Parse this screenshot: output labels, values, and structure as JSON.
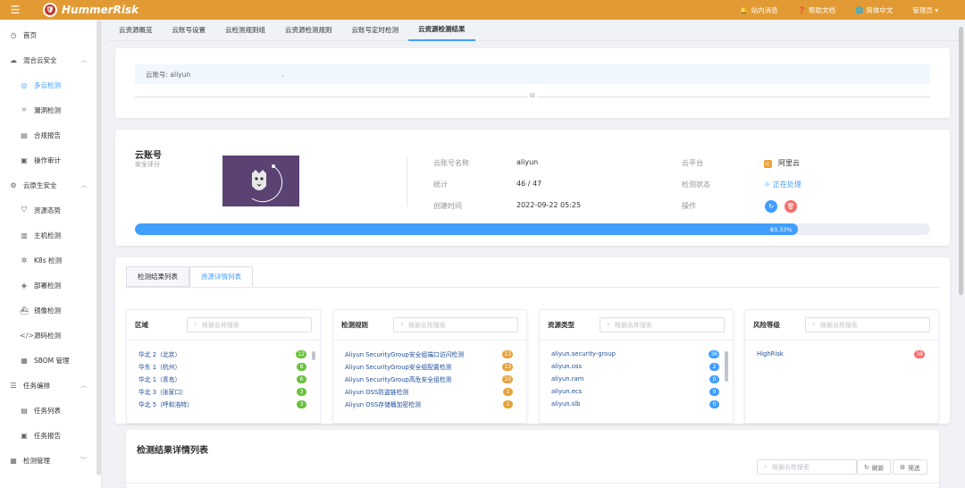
{
  "header": {
    "brand": "HummerRisk",
    "messages": "站内消息",
    "help": "帮助文档",
    "language": "简体中文",
    "user": "管理员"
  },
  "sidebar": {
    "items": [
      {
        "label": "首页",
        "icon": "clock-icon"
      },
      {
        "label": "混合云安全",
        "icon": "cloud-icon"
      },
      {
        "label": "多云检测",
        "icon": "scan-icon"
      },
      {
        "label": "漏洞检测",
        "icon": "bug-icon"
      },
      {
        "label": "合规报告",
        "icon": "report-icon"
      },
      {
        "label": "操作审计",
        "icon": "audit-icon"
      },
      {
        "label": "云原生安全",
        "icon": "gear-icon"
      },
      {
        "label": "资源态势",
        "icon": "shield-icon"
      },
      {
        "label": "主机检测",
        "icon": "server-icon"
      },
      {
        "label": "K8s 检测",
        "icon": "k8s-icon"
      },
      {
        "label": "部署检测",
        "icon": "layers-icon"
      },
      {
        "label": "镜像检测",
        "icon": "image-icon"
      },
      {
        "label": "源码检测",
        "icon": "code-icon"
      },
      {
        "label": "SBOM 管理",
        "icon": "sbom-icon"
      },
      {
        "label": "任务编排",
        "icon": "list-icon"
      },
      {
        "label": "任务列表",
        "icon": "task-icon"
      },
      {
        "label": "任务报告",
        "icon": "doc-icon"
      },
      {
        "label": "检测管理",
        "icon": "grid-icon"
      }
    ]
  },
  "tabs": [
    "云资源概览",
    "云账号设置",
    "云检测规则组",
    "云资源检测规则",
    "云账号定时检测",
    "云资源检测结果"
  ],
  "filter": {
    "account": "云账号: aliyun"
  },
  "account": {
    "title": "云账号",
    "subtitle": "安全评分",
    "name_label": "云账号名称",
    "name_value": "aliyun",
    "stats_label": "统计",
    "stats_value": "46 / 47",
    "created_label": "创建时间",
    "created_value": "2022-09-22 05:25",
    "platform_label": "云平台",
    "platform_value": "阿里云",
    "status_label": "检测状态",
    "status_value": "正在处理",
    "ops_label": "操作",
    "progress": 83.33,
    "progress_text": "83.33%"
  },
  "result_tabs": [
    "检测结果列表",
    "资源详情列表"
  ],
  "panels": [
    {
      "title": "区域",
      "placeholder": "根据名称搜索",
      "rows": [
        {
          "name": "华北 2（北京）",
          "count": "12"
        },
        {
          "name": "华东 1（杭州）",
          "count": "8"
        },
        {
          "name": "华北 1（青岛）",
          "count": "6"
        },
        {
          "name": "华北 3（张家口）",
          "count": "3"
        },
        {
          "name": "华北 5（呼和浩特）",
          "count": "3"
        }
      ]
    },
    {
      "title": "检测规则",
      "placeholder": "根据名称搜索",
      "rows": [
        {
          "name": "Aliyun SecurityGroup安全组端口访问检测",
          "count": "13"
        },
        {
          "name": "Aliyun SecurityGroup安全组配置检测",
          "count": "13"
        },
        {
          "name": "Aliyun SecurityGroup高危安全组检测",
          "count": "10"
        },
        {
          "name": "Aliyun OSS防盗链检测",
          "count": "1"
        },
        {
          "name": "Aliyun OSS存储桶加密检测",
          "count": "1"
        }
      ]
    },
    {
      "title": "资源类型",
      "placeholder": "根据名称搜索",
      "rows": [
        {
          "name": "aliyun.security-group",
          "count": "36"
        },
        {
          "name": "aliyun.oss",
          "count": "2"
        },
        {
          "name": "aliyun.ram",
          "count": "0"
        },
        {
          "name": "aliyun.ecs",
          "count": "0"
        },
        {
          "name": "aliyun.slb",
          "count": "0"
        }
      ]
    },
    {
      "title": "风险等级",
      "placeholder": "根据名称搜索",
      "rows": [
        {
          "name": "HighRisk",
          "count": "38"
        }
      ]
    }
  ],
  "detail": {
    "title": "检测结果详情列表",
    "search_placeholder": "根据名称搜索",
    "refresh": "刷新",
    "filter": "筛选"
  },
  "colors": {
    "brand": "#e29b34",
    "primary": "#409eff",
    "green": "#67c23a",
    "orange": "#e6a23c",
    "red": "#f56c6c"
  }
}
